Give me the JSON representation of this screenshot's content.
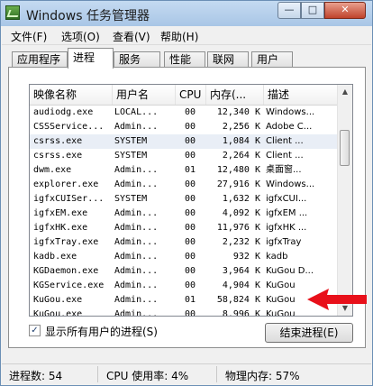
{
  "window": {
    "title": "Windows 任务管理器"
  },
  "titlebar": {
    "minimize": "—",
    "maximize": "□",
    "close": "✕"
  },
  "menu": [
    "文件(F)",
    "选项(O)",
    "查看(V)",
    "帮助(H)"
  ],
  "tabs": [
    "应用程序",
    "进程",
    "服务",
    "性能",
    "联网",
    "用户"
  ],
  "active_tab": "进程",
  "columns": [
    "映像名称",
    "用户名",
    "CPU",
    "内存(...",
    "描述"
  ],
  "processes": [
    {
      "name": "audiodg.exe",
      "user": "LOCAL...",
      "cpu": "00",
      "mem": "12,340 K",
      "desc": "Windows..."
    },
    {
      "name": "CSSService...",
      "user": "Admin...",
      "cpu": "00",
      "mem": "2,256 K",
      "desc": "Adobe C..."
    },
    {
      "name": "csrss.exe",
      "user": "SYSTEM",
      "cpu": "00",
      "mem": "1,084 K",
      "desc": "Client ..."
    },
    {
      "name": "csrss.exe",
      "user": "SYSTEM",
      "cpu": "00",
      "mem": "2,264 K",
      "desc": "Client ..."
    },
    {
      "name": "dwm.exe",
      "user": "Admin...",
      "cpu": "01",
      "mem": "12,480 K",
      "desc": "桌面窗..."
    },
    {
      "name": "explorer.exe",
      "user": "Admin...",
      "cpu": "00",
      "mem": "27,916 K",
      "desc": "Windows..."
    },
    {
      "name": "igfxCUISer...",
      "user": "SYSTEM",
      "cpu": "00",
      "mem": "1,632 K",
      "desc": "igfxCUI..."
    },
    {
      "name": "igfxEM.exe",
      "user": "Admin...",
      "cpu": "00",
      "mem": "4,092 K",
      "desc": "igfxEM ..."
    },
    {
      "name": "igfxHK.exe",
      "user": "Admin...",
      "cpu": "00",
      "mem": "11,976 K",
      "desc": "igfxHK ..."
    },
    {
      "name": "igfxTray.exe",
      "user": "Admin...",
      "cpu": "00",
      "mem": "2,232 K",
      "desc": "igfxTray"
    },
    {
      "name": "kadb.exe",
      "user": "Admin...",
      "cpu": "00",
      "mem": "932 K",
      "desc": "kadb"
    },
    {
      "name": "KGDaemon.exe",
      "user": "Admin...",
      "cpu": "00",
      "mem": "3,964 K",
      "desc": "KuGou D..."
    },
    {
      "name": "KGService.exe",
      "user": "Admin...",
      "cpu": "00",
      "mem": "4,904 K",
      "desc": "KuGou"
    },
    {
      "name": "KuGou.exe",
      "user": "Admin...",
      "cpu": "01",
      "mem": "58,824 K",
      "desc": "KuGou"
    },
    {
      "name": "KuGou.exe",
      "user": "Admin...",
      "cpu": "00",
      "mem": "8,996 K",
      "desc": "KuGou"
    }
  ],
  "selected_row": 2,
  "show_all_users": {
    "label": "显示所有用户的进程(S)",
    "checked": "✓"
  },
  "end_process_button": "结束进程(E)",
  "status": {
    "processes": "进程数: 54",
    "cpu": "CPU 使用率: 4%",
    "memory": "物理内存: 57%"
  },
  "colors": {
    "arrow": "#e8101a",
    "selection": "#e9eef6"
  }
}
